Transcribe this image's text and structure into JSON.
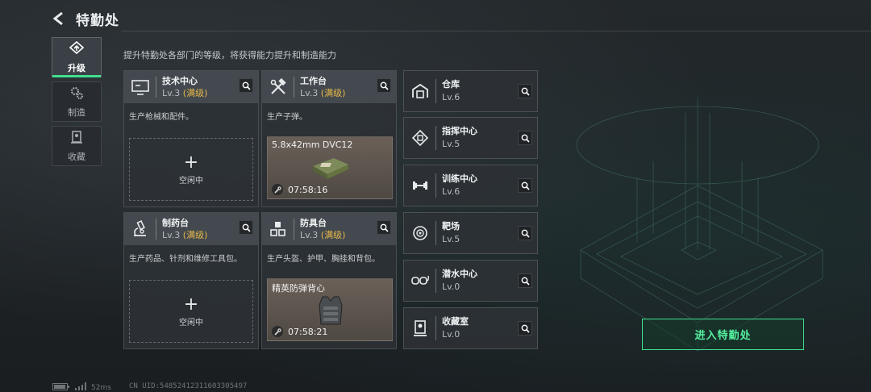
{
  "header": {
    "title": "特勤处",
    "back_icon": "back-arrow-icon"
  },
  "subtitle": "提升特勤处各部门的等级，将获得能力提升和制造能力",
  "nav": {
    "tabs": [
      {
        "label": "升级",
        "icon": "upgrade-icon",
        "active": true
      },
      {
        "label": "制造",
        "icon": "gears-icon",
        "active": false
      },
      {
        "label": "收藏",
        "icon": "collection-icon",
        "active": false
      }
    ]
  },
  "cards": [
    {
      "name": "技术中心",
      "level": "Lv.3",
      "max": "(满级)",
      "desc": "生产枪械和配件。",
      "icon": "monitor-icon",
      "slot": {
        "type": "empty",
        "label": "空闲中"
      }
    },
    {
      "name": "工作台",
      "level": "Lv.3",
      "max": "(满级)",
      "desc": "生产子弹。",
      "icon": "tools-icon",
      "slot": {
        "type": "production",
        "item": "5.8x42mm DVC12",
        "timer": "07:58:16"
      }
    },
    {
      "name": "制药台",
      "level": "Lv.3",
      "max": "(满级)",
      "desc": "生产药品、针剂和维修工具包。",
      "icon": "microscope-icon",
      "slot": {
        "type": "empty",
        "label": "空闲中"
      }
    },
    {
      "name": "防具台",
      "level": "Lv.3",
      "max": "(满级)",
      "desc": "生产头盔、护甲、胸挂和背包。",
      "icon": "cubes-icon",
      "slot": {
        "type": "production",
        "item": "精英防弹背心",
        "timer": "07:58:21"
      }
    }
  ],
  "facilities": [
    {
      "name": "仓库",
      "level": "Lv.6",
      "icon": "warehouse-icon"
    },
    {
      "name": "指挥中心",
      "level": "Lv.5",
      "icon": "chip-icon"
    },
    {
      "name": "训练中心",
      "level": "Lv.6",
      "icon": "dumbbell-icon"
    },
    {
      "name": "靶场",
      "level": "Lv.5",
      "icon": "target-icon"
    },
    {
      "name": "潜水中心",
      "level": "Lv.0",
      "icon": "diving-mask-icon"
    },
    {
      "name": "收藏室",
      "level": "Lv.0",
      "icon": "display-case-icon"
    }
  ],
  "enter_button": "进入特勤处",
  "footer": {
    "ping": "52ms",
    "uid": "CN UID:54852412311603305497"
  },
  "colors": {
    "accent": "#3fe08f",
    "max_level": "#e8b84a"
  }
}
